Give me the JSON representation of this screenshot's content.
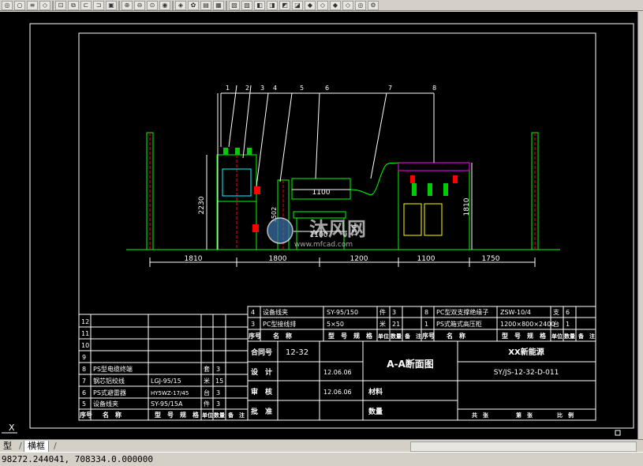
{
  "status": {
    "coordinates": "98272.244041, 708334.0.000000"
  },
  "tabs": {
    "model_label": "型",
    "layout_label": "横框",
    "divider": "/"
  },
  "ucs": {
    "label": "X"
  },
  "drawing": {
    "dims": {
      "left_pole_space": "1810",
      "cabinet_width": "1800",
      "center_gap": "1200",
      "transformer_width": "1100",
      "right_pole_space": "1750",
      "cabinet_height": "2230",
      "bus_width": "1100",
      "base_width": "1100",
      "post_height": "1502",
      "transformer_height": "1810",
      "lower_label": "150"
    },
    "callouts": [
      "1",
      "2",
      "3",
      "4",
      "5",
      "6",
      "7",
      "8"
    ],
    "watermark": {
      "text": "沐风网",
      "url": "www.mfcad.com"
    }
  },
  "bom_top": {
    "rows": [
      {
        "no": "4",
        "name": "设备线夹",
        "spec": "SY-95/150",
        "unit": "件",
        "qty": "3",
        "no2": "8",
        "name2": "PC型双支撑绝缘子",
        "spec2": "ZSW-10/4",
        "unit2": "支",
        "qty2": "6"
      },
      {
        "no": "3",
        "name": "PC型接线排",
        "spec": "5×50",
        "unit": "米",
        "qty": "21",
        "no2": "1",
        "name2": "PS式箱式高压柜",
        "spec2": "1200×800×2400",
        "unit2": "台",
        "qty2": "1"
      }
    ],
    "header": {
      "no": "序号",
      "name": "名　称",
      "spec": "型　号　规　格",
      "unit": "单位",
      "qty": "数量",
      "note": "备　注"
    }
  },
  "bom_left": {
    "rows": [
      {
        "no": "12",
        "name": "",
        "spec": "",
        "unit": "",
        "qty": ""
      },
      {
        "no": "11",
        "name": "",
        "spec": "",
        "unit": "",
        "qty": ""
      },
      {
        "no": "10",
        "name": "",
        "spec": "",
        "unit": "",
        "qty": ""
      },
      {
        "no": "9",
        "name": "",
        "spec": "",
        "unit": "",
        "qty": ""
      },
      {
        "no": "8",
        "name": "PS型电缆终端",
        "spec": "",
        "unit": "套",
        "qty": "3"
      },
      {
        "no": "7",
        "name": "钢芯铝绞线",
        "spec": "LGJ-95/15",
        "unit": "米",
        "qty": "15"
      },
      {
        "no": "6",
        "name": "PS式避雷器",
        "spec": "HY5WZ-17/45",
        "unit": "台",
        "qty": "3"
      },
      {
        "no": "5",
        "name": "设备线夹",
        "spec": "SY-95/15A",
        "unit": "件",
        "qty": "3"
      }
    ],
    "header": {
      "no": "序号",
      "name": "名　称",
      "spec": "型　号　规　格",
      "unit": "单位",
      "qty": "数量",
      "note": "备　注"
    }
  },
  "title_block": {
    "contract_label": "合同号",
    "contract_no": "12-32",
    "design_label": "设　计",
    "design_date": "12.06.06",
    "review_label": "审　核",
    "review_date": "12.06.06",
    "approve_label": "批　准",
    "drawing_title": "A-A断面图",
    "material_label": "材料",
    "quantity_label": "数量",
    "company": "XX新能源",
    "drawing_no": "SY/JS-12-32-D-011",
    "sheet_total_label": "共　张",
    "sheet_label": "第　张",
    "scale_label": "比　例"
  }
}
